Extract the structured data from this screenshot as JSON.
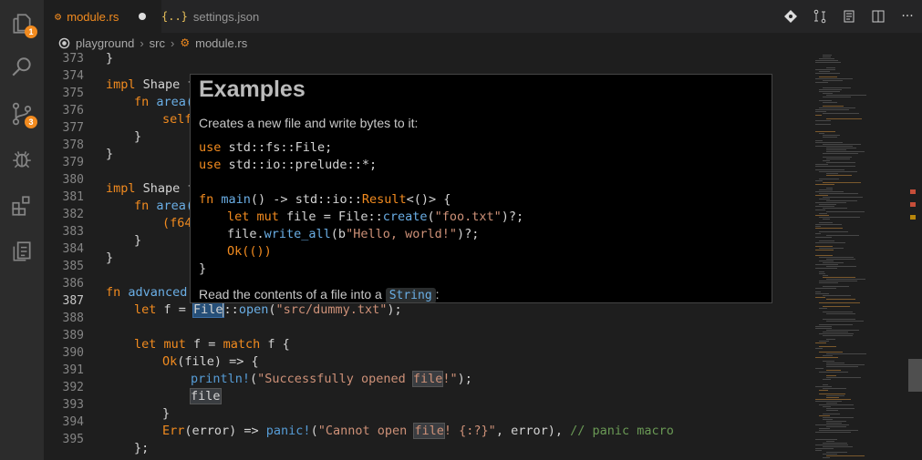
{
  "activity_bar": {
    "explorer_badge": "1",
    "scm_badge": "3"
  },
  "tabs": [
    {
      "icon": "⚙",
      "label": "module.rs",
      "modified": true
    },
    {
      "icon": "{..}",
      "label": "settings.json",
      "modified": false
    }
  ],
  "breadcrumb": {
    "root": "playground",
    "folder": "src",
    "file": "module.rs",
    "separator": "›"
  },
  "lines": {
    "numbers": [
      "373",
      "374",
      "375",
      "376",
      "377",
      "378",
      "379",
      "380",
      "381",
      "382",
      "383",
      "384",
      "385",
      "386",
      "387",
      "388",
      "389",
      "390",
      "391",
      "392",
      "393",
      "394",
      "395"
    ],
    "current": "387"
  },
  "code": {
    "l373": "}",
    "l374_kw": "impl",
    "l374_rest": " Shape f",
    "l375_kw": "fn",
    "l375_fn": "area(",
    "l376": "self",
    "l377": "}",
    "l378": "}",
    "l380_kw": "impl",
    "l380_rest": " Shape f",
    "l381_kw": "fn",
    "l381_fn": "area(",
    "l382": "(f64",
    "l383": "}",
    "l384": "}",
    "l386_kw": "fn",
    "l386_fn": "advanced(",
    "l387_let": "let",
    "l387_a": " f = ",
    "l387_file": "File",
    "l387_b": "::",
    "l387_fn": "open",
    "l387_c": "(",
    "l387_str": "\"src/dummy.txt\"",
    "l387_d": ");",
    "l389_let": "let",
    "l389_mut": "mut",
    "l389_a": " f = ",
    "l389_match": "match",
    "l389_b": " f {",
    "l390_ok": "Ok",
    "l390_rest": "(file) => {",
    "l391_mac": "println!",
    "l391_a": "(",
    "l391_str1": "\"Successfully opened ",
    "l391_file": "file",
    "l391_str2": "!\"",
    "l391_b": ");",
    "l392": "file",
    "l393": "}",
    "l394_err": "Err",
    "l394_a": "(error) => ",
    "l394_mac": "panic!",
    "l394_b": "(",
    "l394_str1": "\"Cannot open ",
    "l394_file": "file",
    "l394_str2": "! {:?}\"",
    "l394_c": ", error), ",
    "l394_cm": "// panic macro",
    "l395": "};"
  },
  "hover": {
    "title": "Examples",
    "intro": "Creates a new file and write bytes to it:",
    "use1_kw": "use",
    "use1_rest": " std::fs::File;",
    "use2_kw": "use",
    "use2_rest": " std::io::prelude::*;",
    "main_kw": "fn",
    "main_fn": "main",
    "main_a": "() -> std::io::",
    "main_ty": "Result",
    "main_b": "<()> {",
    "l1_let": "let",
    "l1_mut": "mut",
    "l1_a": " file = File::",
    "l1_fn": "create",
    "l1_b": "(",
    "l1_str": "\"foo.txt\"",
    "l1_c": ")?;",
    "l2_a": "file.",
    "l2_fn": "write_all",
    "l2_b": "(b",
    "l2_str": "\"Hello, world!\"",
    "l2_c": ")?;",
    "l3": "Ok(())",
    "close": "}",
    "outro": "Read the contents of a file into a ",
    "outro_code": "String",
    "outro_end": ":"
  },
  "colors": {
    "accent": "#f28b1f",
    "function": "#6aaee5",
    "string": "#ce9178",
    "comment": "#6a9955",
    "editor_bg": "#1e1e1e"
  }
}
